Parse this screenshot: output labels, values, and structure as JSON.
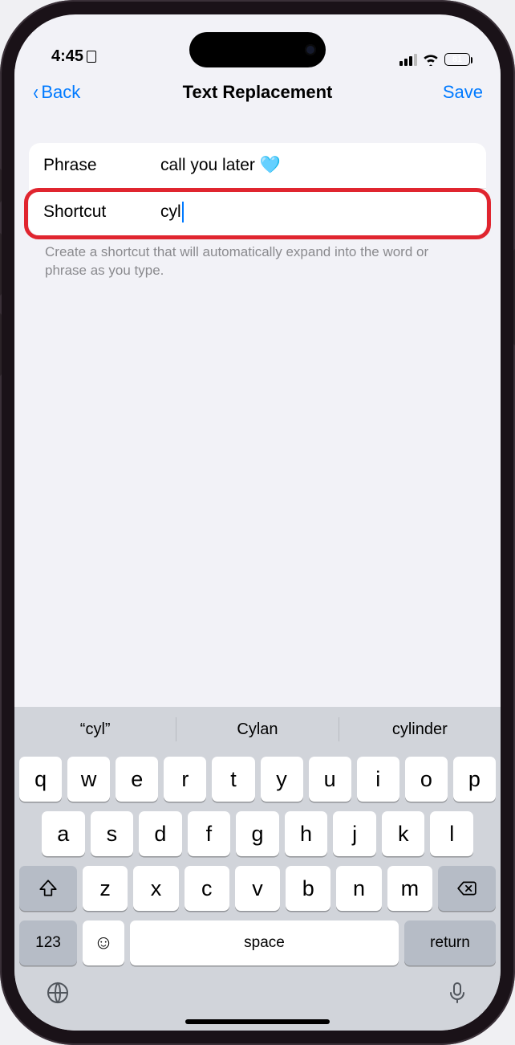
{
  "status": {
    "time": "4:45",
    "battery": "81"
  },
  "nav": {
    "back": "Back",
    "title": "Text Replacement",
    "save": "Save"
  },
  "form": {
    "phrase_label": "Phrase",
    "phrase_value": "call you later 🩵",
    "shortcut_label": "Shortcut",
    "shortcut_value": "cyl",
    "hint": "Create a shortcut that will automatically expand into the word or phrase as you type."
  },
  "suggestions": [
    "“cyl”",
    "Cylan",
    "cylinder"
  ],
  "keys": {
    "row1": [
      "q",
      "w",
      "e",
      "r",
      "t",
      "y",
      "u",
      "i",
      "o",
      "p"
    ],
    "row2": [
      "a",
      "s",
      "d",
      "f",
      "g",
      "h",
      "j",
      "k",
      "l"
    ],
    "row3": [
      "z",
      "x",
      "c",
      "v",
      "b",
      "n",
      "m"
    ],
    "num": "123",
    "space": "space",
    "return": "return"
  }
}
